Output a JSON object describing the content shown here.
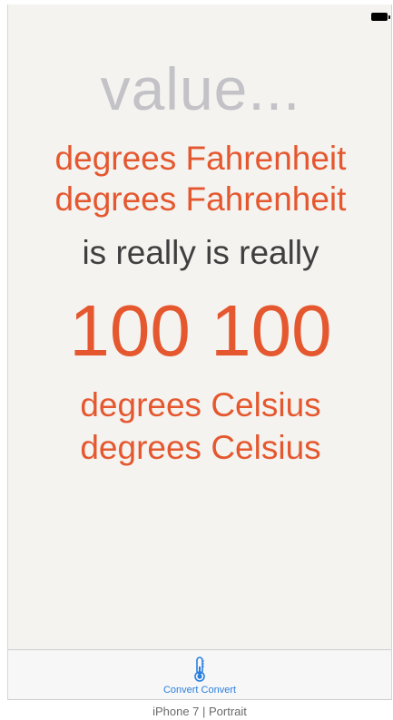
{
  "screen": {
    "input_placeholder": "value...",
    "fahrenheit_line_1": "degrees Fahrenheit",
    "fahrenheit_line_2": "degrees Fahrenheit",
    "connector": "is really is really",
    "converted_value": "100 100",
    "celsius_line_1": "degrees Celsius",
    "celsius_line_2": "degrees Celsius"
  },
  "tabbar": {
    "items": [
      {
        "label": "Convert Convert",
        "icon": "thermometer-icon"
      }
    ]
  },
  "device_caption": "iPhone 7 | Portrait",
  "colors": {
    "accent": "#e5582f",
    "placeholder": "#c2c2c7",
    "text": "#3f3f3f",
    "tab_tint": "#2a7fe0",
    "background": "#f4f3f0"
  }
}
